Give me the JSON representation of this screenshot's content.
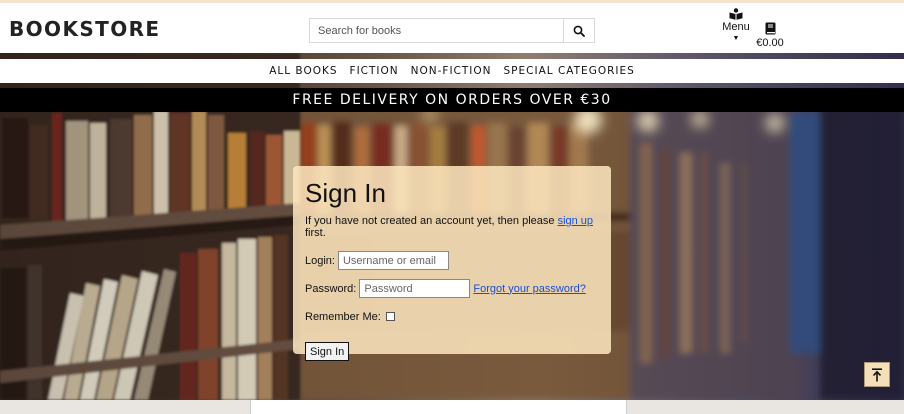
{
  "header": {
    "logo": "BOOKSTORE",
    "search_placeholder": "Search for books",
    "search_icon": "search-icon",
    "menu_label": "Menu",
    "menu_icon": "open-book-icon",
    "cart_total": "€0.00",
    "cart_icon": "book-icon"
  },
  "nav": {
    "items": [
      "ALL BOOKS",
      "FICTION",
      "NON-FICTION",
      "SPECIAL CATEGORIES"
    ]
  },
  "banner": {
    "text": "FREE DELIVERY ON ORDERS OVER €30"
  },
  "signin": {
    "title": "Sign In",
    "intro_before": "If you have not created an account yet, then please ",
    "intro_link": "sign up",
    "intro_after": " first.",
    "login_label": "Login:",
    "login_placeholder": "Username or email",
    "password_label": "Password:",
    "password_placeholder": "Password",
    "forgot_link": "Forgot your password?",
    "remember_label": "Remember Me:",
    "submit_label": "Sign In"
  },
  "back_to_top_icon": "arrow-up-icon",
  "colors": {
    "card_bg": "#fae4bc",
    "link": "#1a4fd6",
    "banner_bg": "#000000",
    "back_to_top_bg": "#f3dfb8"
  }
}
